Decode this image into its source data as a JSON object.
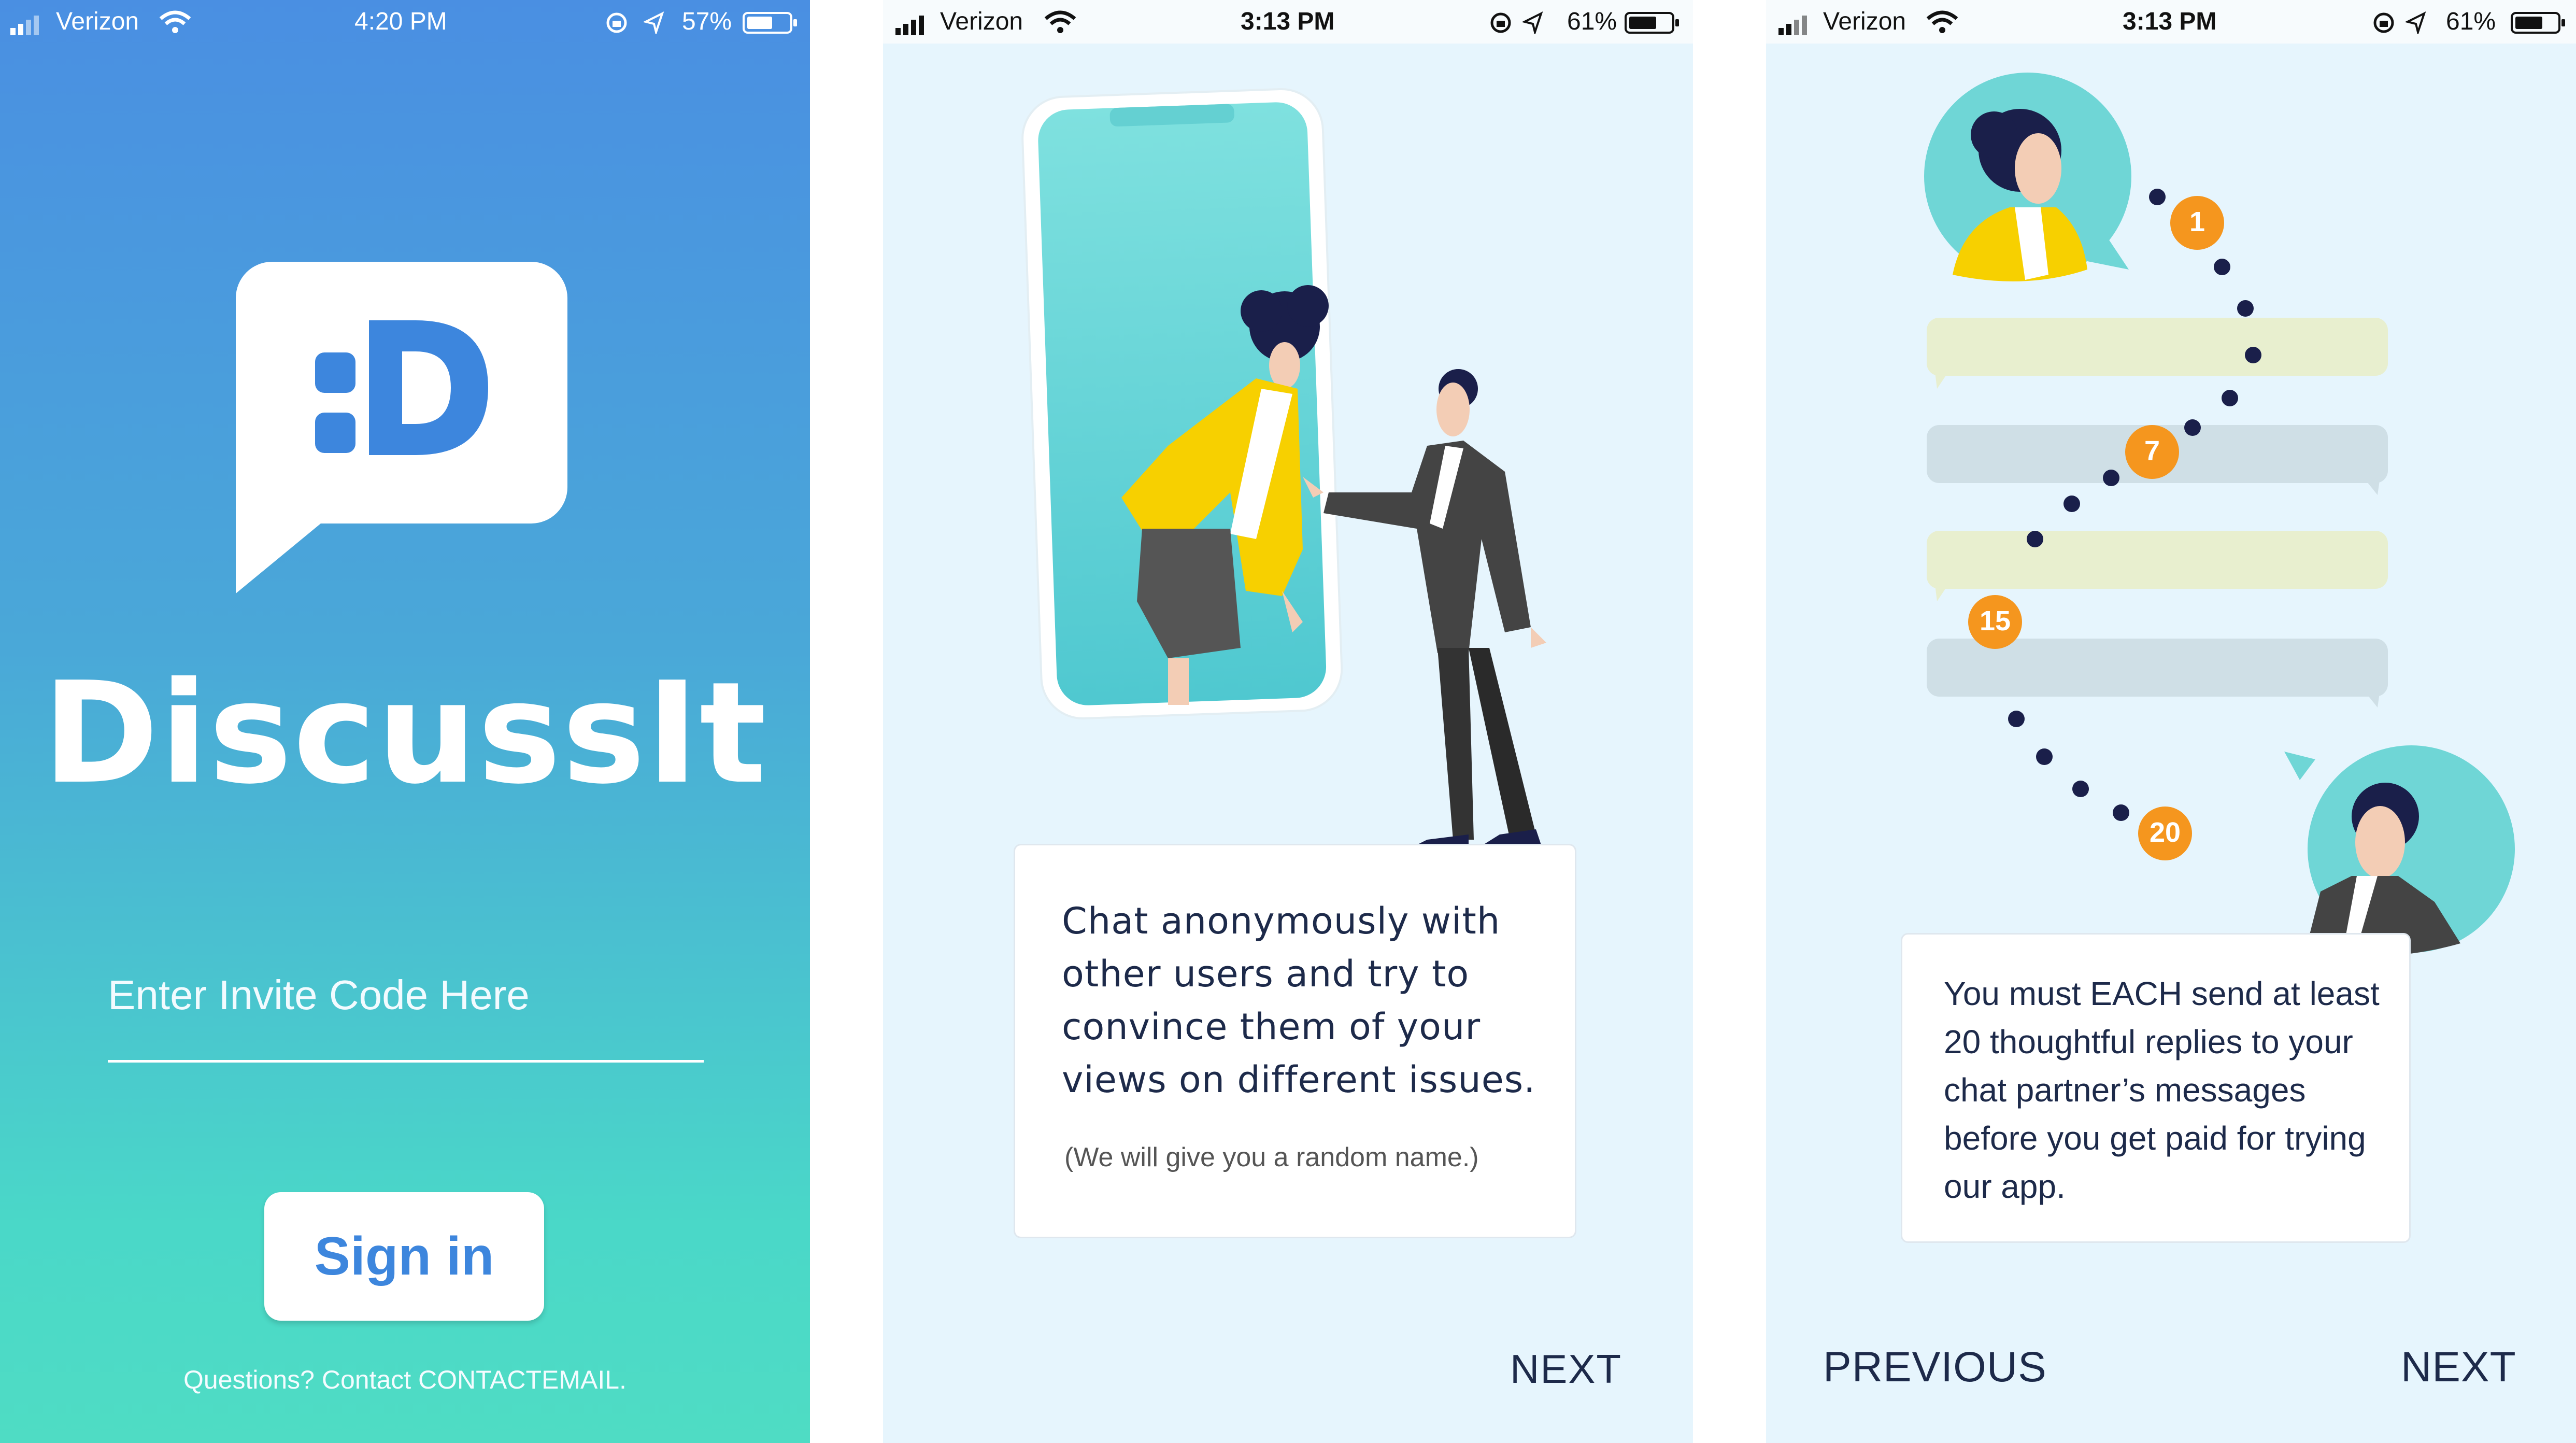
{
  "screens": {
    "login": {
      "status": {
        "carrier": "Verizon",
        "time": "4:20 PM",
        "battery": "57%"
      },
      "app_name": "DiscussIt",
      "logo_text": ":D",
      "invite_placeholder": "Enter Invite Code Here",
      "sign_in_label": "Sign in",
      "contact_text": "Questions? Contact CONTACTEMAIL."
    },
    "onboarding1": {
      "status": {
        "carrier": "Verizon",
        "time": "3:13 PM",
        "battery": "61%"
      },
      "body": "Chat anonymously with other users and try to convince them of your views on different issues.",
      "note": "(We will give you a random name.)",
      "next_label": "NEXT"
    },
    "onboarding2": {
      "status": {
        "carrier": "Verizon",
        "time": "3:13 PM",
        "battery": "61%"
      },
      "milestones": [
        "1",
        "7",
        "15",
        "20"
      ],
      "body": "You must EACH send at least 20 thoughtful replies to your chat partner’s messages before you get paid for trying our app.",
      "previous_label": "PREVIOUS",
      "next_label": "NEXT"
    }
  },
  "colors": {
    "accent_blue": "#3d86dd",
    "gradient_top": "#4a8fe2",
    "gradient_bottom": "#4fdcc4",
    "onboarding_bg": "#e6f5fd",
    "navy": "#1d2a4a",
    "orange": "#f5961e",
    "teal": "#6fd6d6",
    "yellow": "#f7d000"
  },
  "icons": [
    "signal-icon",
    "wifi-icon",
    "orientation-lock-icon",
    "location-arrow-icon",
    "battery-icon",
    "chat-bubble-logo-icon"
  ]
}
